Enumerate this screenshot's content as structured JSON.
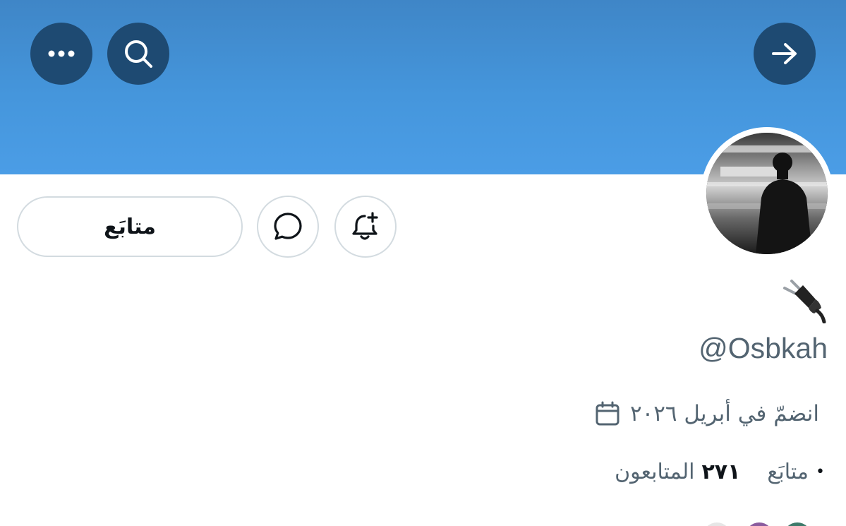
{
  "header": {
    "more_icon": "more-horizontal-icon",
    "search_icon": "search-icon",
    "back_icon": "arrow-right-icon",
    "banner_color": "#4596dc",
    "button_color": "#1e4a72"
  },
  "profile": {
    "handle": "@Osbkah",
    "emoji": "electric-plug-icon",
    "joined_text": "انضمّ في أبريل ٢٠٢٦",
    "joined_icon": "calendar-icon"
  },
  "actions": {
    "follow_label": "متابَع",
    "message_icon": "message-bubble-icon",
    "notify_icon": "bell-plus-icon"
  },
  "stats": {
    "following_label": "متابَع",
    "followers_count": "٢٧١",
    "followers_label": "المتابعون"
  }
}
